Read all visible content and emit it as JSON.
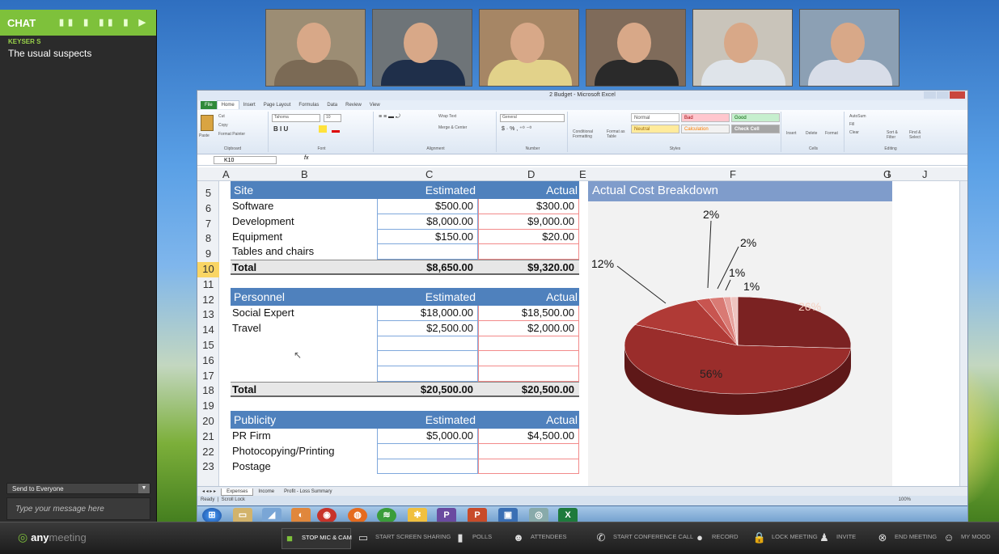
{
  "chat": {
    "title": "CHAT",
    "user": "KEYSER S",
    "message": "The usual suspects",
    "send_to": "Send to Everyone",
    "placeholder": "Type your message here"
  },
  "excel": {
    "title": "2 Budget - Microsoft Excel",
    "tabs": [
      "File",
      "Home",
      "Insert",
      "Page Layout",
      "Formulas",
      "Data",
      "Review",
      "View"
    ],
    "name_box": "K10",
    "fx": "fx",
    "groups": [
      "Clipboard",
      "Font",
      "Alignment",
      "Number",
      "Styles",
      "Cells",
      "Editing"
    ],
    "font_name": "Tahoma",
    "font_size": "10",
    "number_format": "General",
    "wrap_text": "Wrap Text",
    "merge_center": "Merge & Center",
    "styles": {
      "normal": "Normal",
      "bad": "Bad",
      "good": "Good",
      "neutral": "Neutral",
      "calculation": "Calculation",
      "check_cell": "Check Cell"
    },
    "clipboard": {
      "paste": "Paste",
      "cut": "Cut",
      "copy": "Copy",
      "painter": "Format Painter"
    },
    "cond": "Conditional Formatting",
    "format_table": "Format as Table",
    "cells": [
      "Insert",
      "Delete",
      "Format"
    ],
    "editing": {
      "autosum": "AutoSum",
      "fill": "Fill",
      "clear": "Clear",
      "sort": "Sort & Filter",
      "find": "Find & Select"
    },
    "columns": [
      "A",
      "B",
      "C",
      "D",
      "E",
      "F",
      "G",
      "I",
      "J"
    ],
    "rows": [
      "5",
      "6",
      "7",
      "8",
      "9",
      "10",
      "11",
      "12",
      "13",
      "14",
      "15",
      "16",
      "17",
      "18",
      "19",
      "20",
      "21",
      "22",
      "23"
    ],
    "site": {
      "header": "Site",
      "est": "Estimated",
      "act": "Actual",
      "items": [
        [
          "Software",
          "$500.00",
          "$300.00"
        ],
        [
          "Development",
          "$8,000.00",
          "$9,000.00"
        ],
        [
          "Equipment",
          "$150.00",
          "$20.00"
        ],
        [
          "Tables and chairs",
          "",
          ""
        ]
      ],
      "total": [
        "Total",
        "$8,650.00",
        "$9,320.00"
      ]
    },
    "personnel": {
      "header": "Personnel",
      "est": "Estimated",
      "act": "Actual",
      "items": [
        [
          "Social Expert",
          "$18,000.00",
          "$18,500.00"
        ],
        [
          "Travel",
          "$2,500.00",
          "$2,000.00"
        ],
        [
          "",
          "",
          ""
        ],
        [
          "",
          "",
          ""
        ],
        [
          "",
          "",
          ""
        ]
      ],
      "total": [
        "Total",
        "$20,500.00",
        "$20,500.00"
      ]
    },
    "publicity": {
      "header": "Publicity",
      "est": "Estimated",
      "act": "Actual",
      "items": [
        [
          "PR Firm",
          "$5,000.00",
          "$4,500.00"
        ],
        [
          "Photocopying/Printing",
          "",
          ""
        ],
        [
          "Postage",
          "",
          ""
        ]
      ]
    },
    "sheet_tabs": [
      "Expenses",
      "Income",
      "Profit - Loss Summary"
    ],
    "status": [
      "Ready",
      "Scroll Lock"
    ],
    "zoom": "100%"
  },
  "chart_data": {
    "type": "pie",
    "title": "Actual Cost Breakdown",
    "values": [
      26,
      56,
      12,
      2,
      2,
      1,
      1
    ],
    "labels": [
      "26%",
      "56%",
      "12%",
      "2%",
      "2%",
      "1%",
      "1%"
    ],
    "colors": [
      "#7b2222",
      "#9a2d2b",
      "#b03a36",
      "#c85550",
      "#d97a74",
      "#e6a19c",
      "#efc4c0"
    ]
  },
  "bar": {
    "logo_a": "any",
    "logo_b": "meeting",
    "buttons": [
      {
        "label": "STOP MIC & CAM",
        "icon": "camera-icon"
      },
      {
        "label": "START SCREEN SHARING",
        "icon": "monitor-icon"
      },
      {
        "label": "POLLS",
        "icon": "polls-icon"
      },
      {
        "label": "ATTENDEES",
        "icon": "attendees-icon"
      },
      {
        "label": "START CONFERENCE CALL",
        "icon": "phone-icon"
      },
      {
        "label": "RECORD",
        "icon": "record-icon"
      },
      {
        "label": "LOCK MEETING",
        "icon": "lock-icon"
      },
      {
        "label": "INVITE",
        "icon": "invite-icon"
      },
      {
        "label": "END MEETING",
        "icon": "end-icon"
      },
      {
        "label": "MY MOOD",
        "icon": "mood-icon"
      }
    ]
  },
  "webcams": [
    {
      "bg": "#9c8d74",
      "shirt": "#7b6a55"
    },
    {
      "bg": "#6e7478",
      "shirt": "#1f2f4a"
    },
    {
      "bg": "#a68665",
      "shirt": "#e2d28a"
    },
    {
      "bg": "#7f6b5a",
      "shirt": "#2a2a2a"
    },
    {
      "bg": "#c9c4ba",
      "shirt": "#dfe4ea"
    },
    {
      "bg": "#8ca0b4",
      "shirt": "#d8dde8"
    }
  ]
}
